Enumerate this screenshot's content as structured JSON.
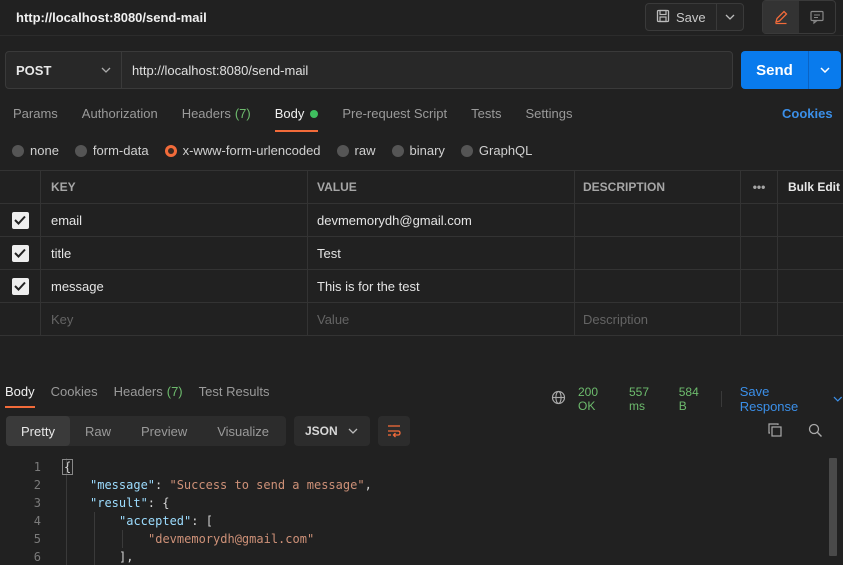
{
  "request": {
    "title": "http://localhost:8080/send-mail",
    "save_label": "Save",
    "method": "POST",
    "url": "http://localhost:8080/send-mail",
    "send_label": "Send"
  },
  "request_tabs": [
    {
      "label": "Params"
    },
    {
      "label": "Authorization"
    },
    {
      "label": "Headers",
      "count": "(7)"
    },
    {
      "label": "Body",
      "active": true
    },
    {
      "label": "Pre-request Script"
    },
    {
      "label": "Tests"
    },
    {
      "label": "Settings"
    }
  ],
  "cookies_label": "Cookies",
  "body_types": [
    "none",
    "form-data",
    "x-www-form-urlencoded",
    "raw",
    "binary",
    "GraphQL"
  ],
  "body_type_selected": "x-www-form-urlencoded",
  "table": {
    "headers": {
      "key": "KEY",
      "value": "VALUE",
      "description": "DESCRIPTION",
      "more": "•••",
      "bulk_edit": "Bulk Edit"
    },
    "rows": [
      {
        "checked": true,
        "key": "email",
        "value": "devmemorydh@gmail.com",
        "description": ""
      },
      {
        "checked": true,
        "key": "title",
        "value": "Test",
        "description": ""
      },
      {
        "checked": true,
        "key": "message",
        "value": "This is for the test",
        "description": ""
      }
    ],
    "placeholders": {
      "key": "Key",
      "value": "Value",
      "description": "Description"
    }
  },
  "response": {
    "tabs": [
      {
        "label": "Body",
        "active": true
      },
      {
        "label": "Cookies"
      },
      {
        "label": "Headers",
        "count": "(7)"
      },
      {
        "label": "Test Results"
      }
    ],
    "status": "200 OK",
    "time": "557 ms",
    "size": "584 B",
    "save_response_label": "Save Response",
    "views": [
      "Pretty",
      "Raw",
      "Preview",
      "Visualize"
    ],
    "format": "JSON",
    "line_numbers": [
      "1",
      "2",
      "3",
      "4",
      "5",
      "6"
    ],
    "code": {
      "line1": "{",
      "message_key": "\"message\"",
      "message_value": "\"Success to send a message\"",
      "result_key": "\"result\"",
      "accepted_key": "\"accepted\"",
      "accepted_item": "\"devmemorydh@gmail.com\"",
      "line6": "],"
    }
  },
  "colors": {
    "accent": "#f26b3a",
    "primary": "#097bed",
    "success": "#6dbb6d",
    "link": "#3b8fe8"
  }
}
